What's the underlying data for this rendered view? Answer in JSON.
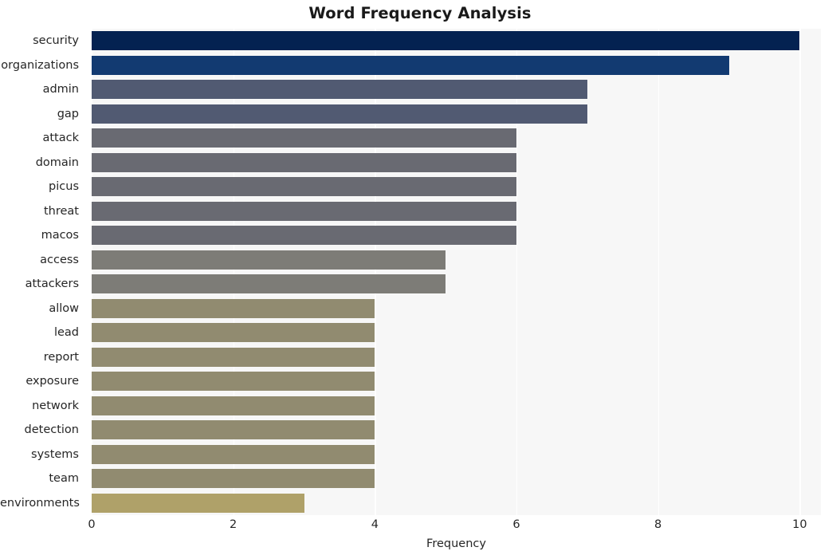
{
  "chart_data": {
    "type": "bar",
    "orientation": "horizontal",
    "title": "Word Frequency Analysis",
    "xlabel": "Frequency",
    "ylabel": "",
    "categories": [
      "security",
      "organizations",
      "admin",
      "gap",
      "attack",
      "domain",
      "picus",
      "threat",
      "macos",
      "access",
      "attackers",
      "allow",
      "lead",
      "report",
      "exposure",
      "network",
      "detection",
      "systems",
      "team",
      "environments"
    ],
    "values": [
      10,
      9,
      7,
      7,
      6,
      6,
      6,
      6,
      6,
      5,
      5,
      4,
      4,
      4,
      4,
      4,
      4,
      4,
      4,
      3
    ],
    "bar_colors": [
      "#042251",
      "#123a71",
      "#515a72",
      "#515a72",
      "#696a72",
      "#696a72",
      "#696a72",
      "#696a72",
      "#696a72",
      "#7d7c77",
      "#7d7c77",
      "#918b70",
      "#918b70",
      "#918b70",
      "#918b70",
      "#918b70",
      "#918b70",
      "#918b70",
      "#918b70",
      "#afa169"
    ],
    "xticks": [
      "0",
      "2",
      "4",
      "6",
      "8",
      "10"
    ],
    "xtick_values": [
      0,
      2,
      4,
      6,
      8,
      10
    ],
    "xlim": [
      0,
      10.3
    ],
    "grid": true,
    "grid_axis": "x",
    "legend": "none",
    "plot_background": "#f7f7f7",
    "figure_background": "#ffffff",
    "gridline_color": "#ffffff"
  }
}
